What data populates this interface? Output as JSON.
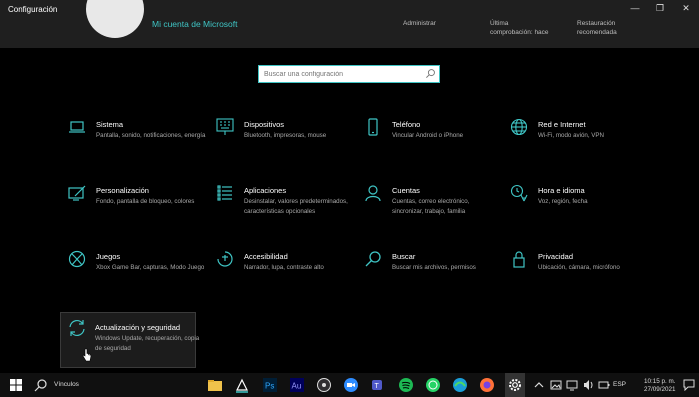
{
  "window": {
    "title": "Configuración",
    "minimize": "—",
    "maximize": "❐",
    "close": "✕"
  },
  "header": {
    "account_link": "Mi cuenta de Microsoft",
    "manage": "Administrar",
    "last_check_1": "Última",
    "last_check_2": "comprobación: hace",
    "restore_1": "Restauración",
    "restore_2": "recomendada"
  },
  "search": {
    "placeholder": "Buscar una configuración"
  },
  "tiles": [
    {
      "title": "Sistema",
      "desc": "Pantalla, sonido, notificaciones, energía",
      "icon": "laptop-icon"
    },
    {
      "title": "Dispositivos",
      "desc": "Bluetooth, impresoras, mouse",
      "icon": "keyboard-icon"
    },
    {
      "title": "Teléfono",
      "desc": "Vincular Android o iPhone",
      "icon": "phone-icon"
    },
    {
      "title": "Red e Internet",
      "desc": "Wi-Fi, modo avión, VPN",
      "icon": "globe-icon"
    },
    {
      "title": "Personalización",
      "desc": "Fondo, pantalla de bloqueo, colores",
      "icon": "paint-icon"
    },
    {
      "title": "Aplicaciones",
      "desc": "Desinstalar, valores predeterminados, características opcionales",
      "icon": "apps-list-icon"
    },
    {
      "title": "Cuentas",
      "desc": "Cuentas, correo electrónico, sincronizar, trabajo, familia",
      "icon": "person-icon"
    },
    {
      "title": "Hora e idioma",
      "desc": "Voz, región, fecha",
      "icon": "time-language-icon"
    },
    {
      "title": "Juegos",
      "desc": "Xbox Game Bar, capturas, Modo Juego",
      "icon": "xbox-icon"
    },
    {
      "title": "Accesibilidad",
      "desc": "Narrador, lupa, contraste alto",
      "icon": "accessibility-icon"
    },
    {
      "title": "Buscar",
      "desc": "Buscar mis archivos, permisos",
      "icon": "search-icon"
    },
    {
      "title": "Privacidad",
      "desc": "Ubicación, cámara, micrófono",
      "icon": "lock-icon"
    },
    {
      "title": "Actualización y seguridad",
      "desc": "Windows Update, recuperación, copia de seguridad",
      "icon": "sync-icon"
    }
  ],
  "taskbar": {
    "search_label": "Vínculos",
    "language": "ESP",
    "time": "10:15 p. m.",
    "date": "27/09/2021"
  },
  "colors": {
    "accent": "#3fc5c5",
    "background": "#000000",
    "header": "#1f1f1f"
  }
}
